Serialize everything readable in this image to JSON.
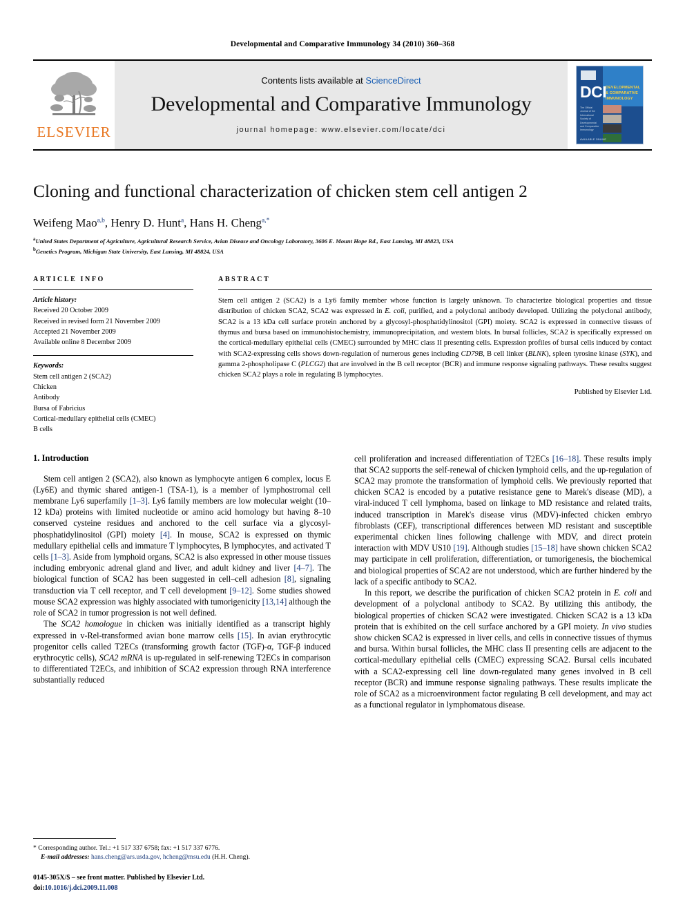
{
  "running_head": "Developmental and Comparative Immunology 34 (2010) 360–368",
  "masthead": {
    "contents_prefix": "Contents lists available at ",
    "sciencedirect": "ScienceDirect",
    "journal_title": "Developmental and Comparative Immunology",
    "homepage": "journal homepage: www.elsevier.com/locate/dci",
    "publisher_wordmark": "ELSEVIER",
    "cover": {
      "acronym": "DCI",
      "full_title": "DEVELOPMENTAL & COMPARATIVE IMMUNOLOGY",
      "blurb": "The Official Journal of the International Society of Developmental and Comparative Immunology",
      "bottom_text": "AVAILABLE ONLINE"
    }
  },
  "article": {
    "title": "Cloning and functional characterization of chicken stem cell antigen 2",
    "authors": [
      {
        "name": "Weifeng Mao",
        "marks": "a,b"
      },
      {
        "name": "Henry D. Hunt",
        "marks": "a"
      },
      {
        "name": "Hans H. Cheng",
        "marks": "a,*"
      }
    ],
    "affiliations": [
      {
        "mark": "a",
        "text": "United States Department of Agriculture, Agricultural Research Service, Avian Disease and Oncology Laboratory, 3606 E. Mount Hope Rd., East Lansing, MI 48823, USA"
      },
      {
        "mark": "b",
        "text": "Genetics Program, Michigan State University, East Lansing, MI 48824, USA"
      }
    ]
  },
  "article_info": {
    "heading": "ARTICLE INFO",
    "history_label": "Article history:",
    "history": [
      "Received 20 October 2009",
      "Received in revised form 21 November 2009",
      "Accepted 21 November 2009",
      "Available online 8 December 2009"
    ],
    "keywords_label": "Keywords:",
    "keywords": [
      "Stem cell antigen 2 (SCA2)",
      "Chicken",
      "Antibody",
      "Bursa of Fabricius",
      "Cortical-medullary epithelial cells (CMEC)",
      "B cells"
    ]
  },
  "abstract": {
    "heading": "ABSTRACT",
    "paragraphs": [
      "Stem cell antigen 2 (SCA2) is a Ly6 family member whose function is largely unknown. To characterize biological properties and tissue distribution of chicken SCA2, SCA2 was expressed in E. coli, purified, and a polyclonal antibody developed. Utilizing the polyclonal antibody, SCA2 is a 13 kDa cell surface protein anchored by a glycosyl-phosphatidylinositol (GPI) moiety. SCA2 is expressed in connective tissues of thymus and bursa based on immunohistochemistry, immunoprecipitation, and western blots. In bursal follicles, SCA2 is specifically expressed on the cortical-medullary epithelial cells (CMEC) surrounded by MHC class II presenting cells. Expression profiles of bursal cells induced by contact with SCA2-expressing cells shows down-regulation of numerous genes including CD79B, B cell linker (BLNK), spleen tyrosine kinase (SYK), and gamma 2-phospholipase C (PLCG2) that are involved in the B cell receptor (BCR) and immune response signaling pathways. These results suggest chicken SCA2 plays a role in regulating B lymphocytes."
    ],
    "publisher_line": "Published by Elsevier Ltd."
  },
  "body": {
    "section_heading": "1. Introduction",
    "left_paragraphs": [
      "Stem cell antigen 2 (SCA2), also known as lymphocyte antigen 6 complex, locus E (Ly6E) and thymic shared antigen-1 (TSA-1), is a member of lymphostromal cell membrane Ly6 superfamily [1–3]. Ly6 family members are low molecular weight (10–12 kDa) proteins with limited nucleotide or amino acid homology but having 8–10 conserved cysteine residues and anchored to the cell surface via a glycosyl-phosphatidylinositol (GPI) moiety [4]. In mouse, SCA2 is expressed on thymic medullary epithelial cells and immature T lymphocytes, B lymphocytes, and activated T cells [1–3]. Aside from lymphoid organs, SCA2 is also expressed in other mouse tissues including embryonic adrenal gland and liver, and adult kidney and liver [4–7]. The biological function of SCA2 has been suggested in cell–cell adhesion [8], signaling transduction via T cell receptor, and T cell development [9–12]. Some studies showed mouse SCA2 expression was highly associated with tumorigenicity [13,14] although the role of SCA2 in tumor progression is not well defined.",
      "The SCA2 homologue in chicken was initially identified as a transcript highly expressed in v-Rel-transformed avian bone marrow cells [15]. In avian erythrocytic progenitor cells called T2ECs (transforming growth factor (TGF)-α, TGF-β induced erythrocytic cells), SCA2 mRNA is up-regulated in self-renewing T2ECs in comparison to differentiated T2ECs, and inhibition of SCA2 expression through RNA interference substantially reduced"
    ],
    "right_paragraphs": [
      "cell proliferation and increased differentiation of T2ECs [16–18]. These results imply that SCA2 supports the self-renewal of chicken lymphoid cells, and the up-regulation of SCA2 may promote the transformation of lymphoid cells. We previously reported that chicken SCA2 is encoded by a putative resistance gene to Marek's disease (MD), a viral-induced T cell lymphoma, based on linkage to MD resistance and related traits, induced transcription in Marek's disease virus (MDV)-infected chicken embryo fibroblasts (CEF), transcriptional differences between MD resistant and susceptible experimental chicken lines following challenge with MDV, and direct protein interaction with MDV US10 [19]. Although studies [15–18] have shown chicken SCA2 may participate in cell proliferation, differentiation, or tumorigenesis, the biochemical and biological properties of SCA2 are not understood, which are further hindered by the lack of a specific antibody to SCA2.",
      "In this report, we describe the purification of chicken SCA2 protein in E. coli and development of a polyclonal antibody to SCA2. By utilizing this antibody, the biological properties of chicken SCA2 were investigated. Chicken SCA2 is a 13 kDa protein that is exhibited on the cell surface anchored by a GPI moiety. In vivo studies show chicken SCA2 is expressed in liver cells, and cells in connective tissues of thymus and bursa. Within bursal follicles, the MHC class II presenting cells are adjacent to the cortical-medullary epithelial cells (CMEC) expressing SCA2. Bursal cells incubated with a SCA2-expressing cell line down-regulated many genes involved in B cell receptor (BCR) and immune response signaling pathways. These results implicate the role of SCA2 as a microenvironment factor regulating B cell development, and may act as a functional regulator in lymphomatous disease."
    ]
  },
  "footnotes": {
    "corresponding": "Corresponding author. Tel.: +1 517 337 6758; fax: +1 517 337 6776.",
    "email_label": "E-mail addresses:",
    "emails": "hans.cheng@ars.usda.gov, hcheng@msu.edu",
    "email_suffix": "(H.H. Cheng).",
    "issn_line": "0145-305X/$ – see front matter. Published by Elsevier Ltd.",
    "doi_label": "doi:",
    "doi_value": "10.1016/j.dci.2009.11.008"
  },
  "colors": {
    "link": "#1a3a7a",
    "sciencedirect": "#1a5fb4",
    "elsevier_orange": "#E87722",
    "cover_blue": "#1c4e8f"
  }
}
